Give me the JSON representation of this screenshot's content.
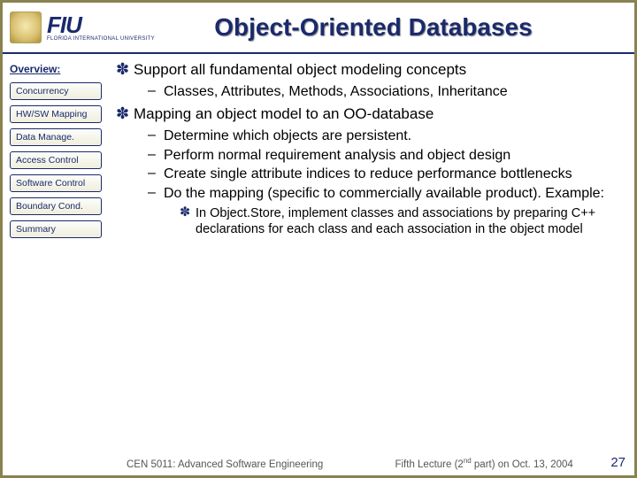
{
  "header": {
    "wordmark_big": "FIU",
    "wordmark_small": "FLORIDA INTERNATIONAL UNIVERSITY",
    "title": "Object-Oriented Databases"
  },
  "sidebar": {
    "overview_label": "Overview:",
    "items": [
      "Concurrency",
      "HW/SW Mapping",
      "Data Manage.",
      "Access Control",
      "Software Control",
      "Boundary Cond.",
      "Summary"
    ]
  },
  "content": {
    "b1_0": "Support all fundamental object modeling concepts",
    "b2_0": "Classes, Attributes, Methods, Associations, Inheritance",
    "b1_1": "Mapping an object model to an OO-database",
    "b2_1": "Determine which objects are persistent.",
    "b2_2": "Perform normal requirement analysis and object design",
    "b2_3": "Create single attribute indices to reduce performance bottlenecks",
    "b2_4": "Do the mapping (specific to commercially available product). Example:",
    "b3_0": "In Object.Store, implement classes and associations by preparing C++ declarations for each class and each association in the object model"
  },
  "footer": {
    "course": "CEN 5011: Advanced Software Engineering",
    "lecture_pre": "Fifth Lecture (2",
    "lecture_sup": "nd",
    "lecture_post": " part) on Oct. 13, 2004",
    "page": "27"
  }
}
